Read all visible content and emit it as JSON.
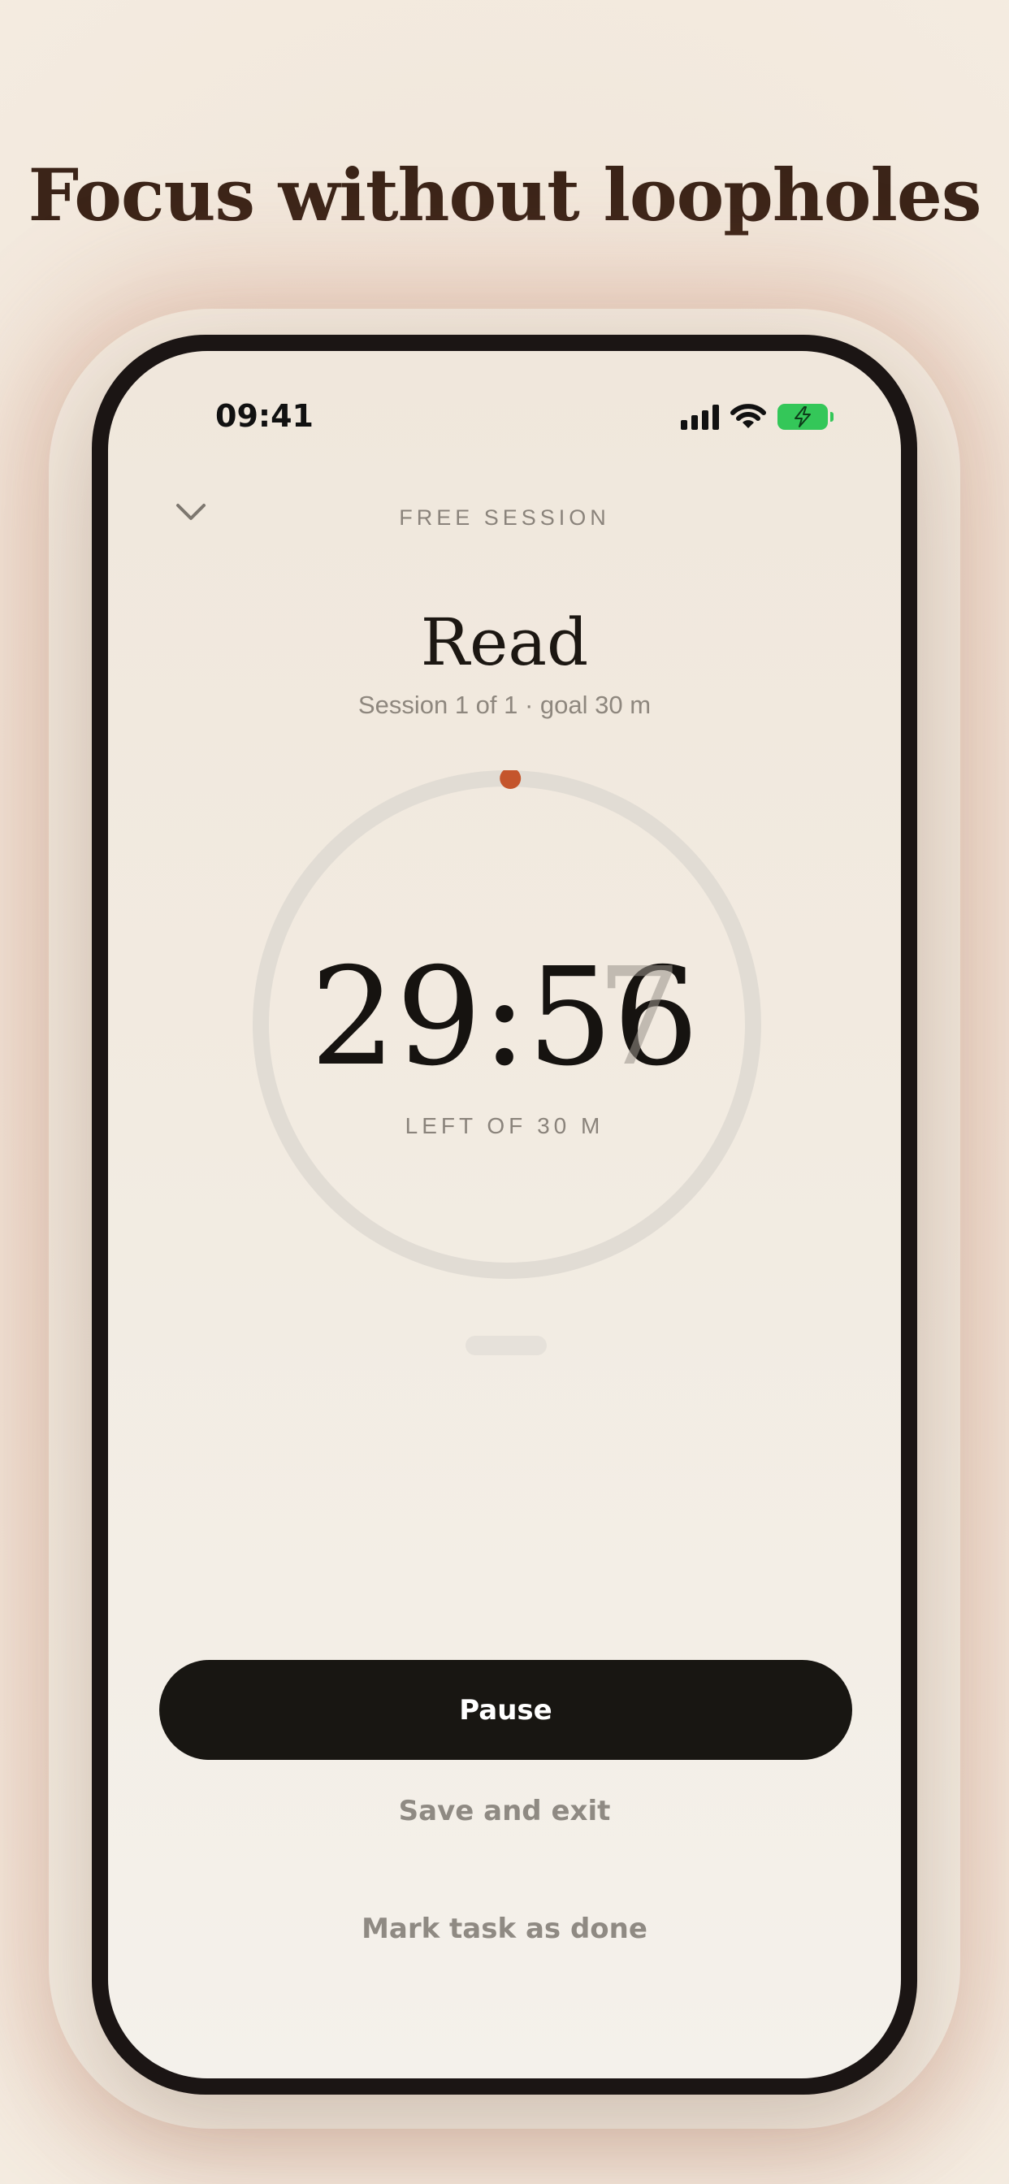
{
  "headline": "Focus without loopholes",
  "status_bar": {
    "time": "09:41",
    "signal_icon": "cellular-signal-icon",
    "wifi_icon": "wifi-icon",
    "battery_icon": "battery-charging-icon",
    "battery_color": "#34c759"
  },
  "header": {
    "collapse_icon": "chevron-down-icon",
    "session_type": "FREE SESSION"
  },
  "task": {
    "title": "Read",
    "subtitle": "Session 1 of 1 · goal 30 m"
  },
  "timer": {
    "display": "29:56",
    "ghost_digit": "7",
    "caption": "LEFT OF 30 M",
    "progress_fraction": 0.0022,
    "accent_color": "#c4552c"
  },
  "actions": {
    "pause_label": "Pause",
    "save_exit_label": "Save and exit",
    "mark_done_label": "Mark task as done"
  }
}
